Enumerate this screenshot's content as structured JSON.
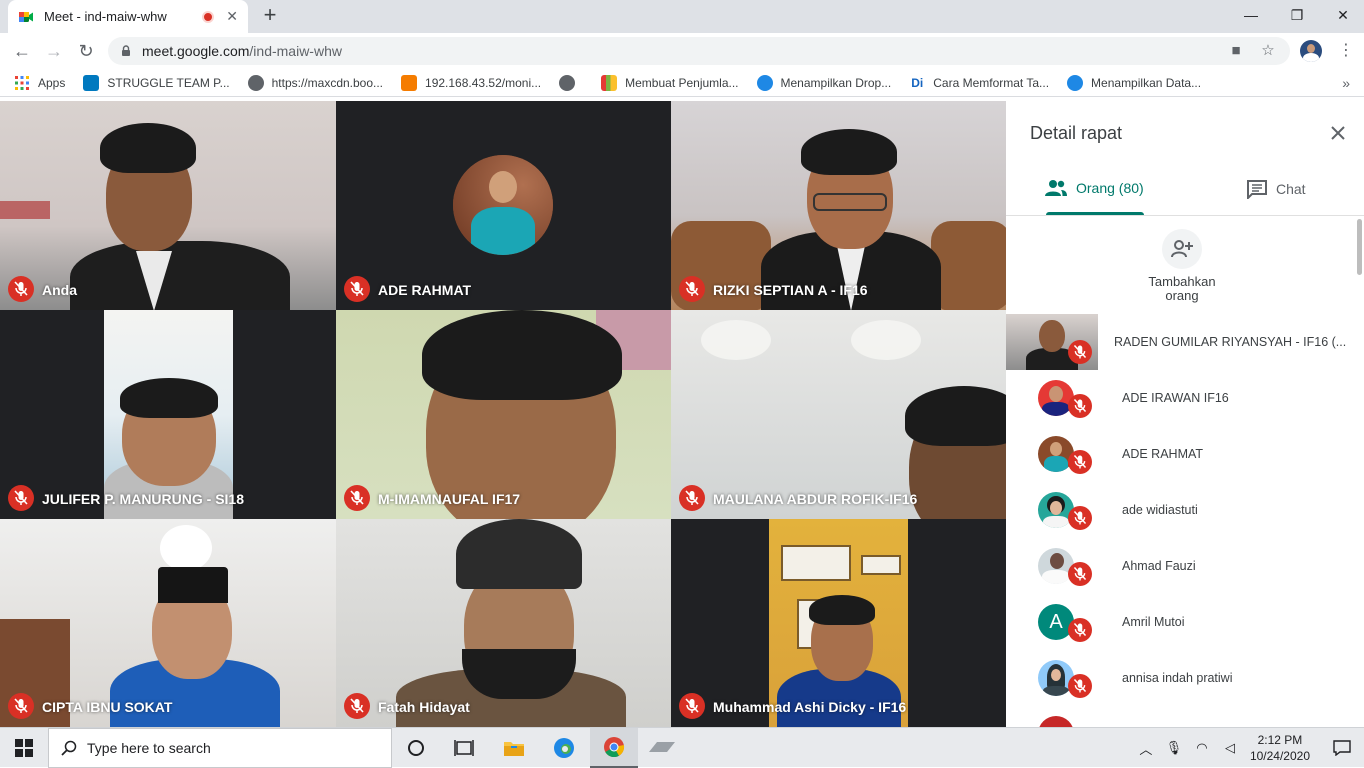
{
  "browser": {
    "tab_title": "Meet - ind-maiw-whw",
    "url_host": "meet.google.com",
    "url_path": "/ind-maiw-whw",
    "bookmarks": [
      {
        "label": "Apps",
        "icon": "apps-grid-icon",
        "color": "#ea4335"
      },
      {
        "label": "STRUGGLE TEAM P...",
        "icon": "trello-icon",
        "color": "#0079bf"
      },
      {
        "label": "https://maxcdn.boo...",
        "icon": "globe-icon",
        "color": "#5f6368"
      },
      {
        "label": "192.168.43.52/moni...",
        "icon": "router-icon",
        "color": "#f57c00"
      },
      {
        "label": "",
        "icon": "globe-icon",
        "color": "#5f6368"
      },
      {
        "label": "Membuat Penjumla...",
        "icon": "chart-icon",
        "color": "#7cb342"
      },
      {
        "label": "Menampilkan Drop...",
        "icon": "site-icon",
        "color": "#1e88e5"
      },
      {
        "label": "Cara Memformat Ta...",
        "icon": "di-icon",
        "color": "#1565c0"
      },
      {
        "label": "Menampilkan Data...",
        "icon": "site-icon",
        "color": "#1e88e5"
      }
    ]
  },
  "meet": {
    "tiles": [
      {
        "name": "Anda"
      },
      {
        "name": "ADE RAHMAT"
      },
      {
        "name": "RIZKI SEPTIAN A - IF16"
      },
      {
        "name": "JULIFER P. MANURUNG - SI18"
      },
      {
        "name": "M-IMAMNAUFAL IF17"
      },
      {
        "name": "MAULANA ABDUR ROFIK-IF16"
      },
      {
        "name": "CIPTA IBNU SOKAT"
      },
      {
        "name": "Fatah Hidayat"
      },
      {
        "name": "Muhammad Ashi Dicky - IF16"
      }
    ],
    "panel": {
      "title": "Detail rapat",
      "tab_people": "Orang (80)",
      "tab_chat": "Chat",
      "add_people": "Tambahkan orang",
      "participants": [
        {
          "name": "RADEN GUMILAR RIYANSYAH - IF16 (..."
        },
        {
          "name": "ADE IRAWAN IF16"
        },
        {
          "name": "ADE RAHMAT"
        },
        {
          "name": "ade widiastuti"
        },
        {
          "name": "Ahmad Fauzi"
        },
        {
          "name": "Amril Mutoi",
          "initial": "A"
        },
        {
          "name": "annisa indah pratiwi"
        }
      ]
    }
  },
  "taskbar": {
    "search_placeholder": "Type here to search",
    "time": "2:12 PM",
    "date": "10/24/2020"
  },
  "colors": {
    "accent": "#00796b",
    "mute_red": "#d93025"
  }
}
